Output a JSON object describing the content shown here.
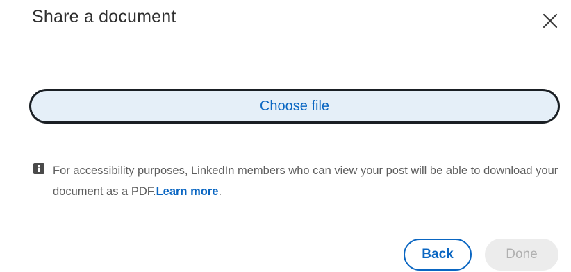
{
  "dialog": {
    "title": "Share a document",
    "close_icon": "close-icon"
  },
  "upload": {
    "choose_file_label": "Choose file"
  },
  "notice": {
    "icon": "info-icon",
    "text": "For accessibility purposes, LinkedIn members who can view your post will be able to download your document as a PDF.",
    "link_label": "Learn more",
    "trailing": "."
  },
  "footer": {
    "back_label": "Back",
    "done_label": "Done"
  },
  "colors": {
    "accent": "#0a66c2",
    "button_fill": "#e5eff8",
    "disabled_bg": "#ececec",
    "disabled_text": "#b0b0b0"
  }
}
